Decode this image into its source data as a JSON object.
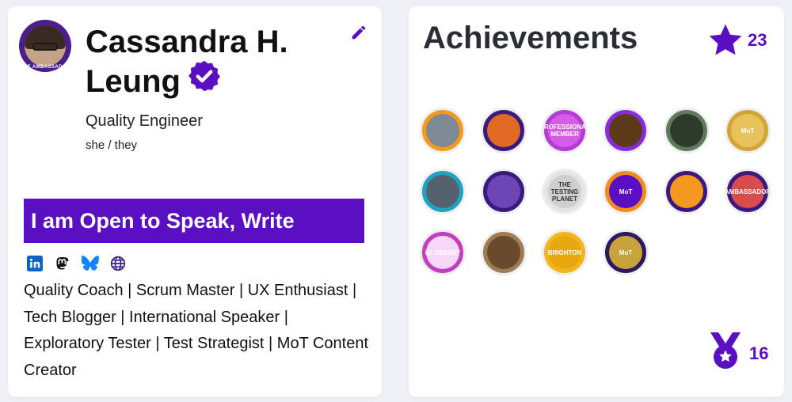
{
  "profile": {
    "avatar_ring_text": "MoT AMBASSADOR",
    "name_line1": "Cassandra H.",
    "name_line2": "Leung",
    "role": "Quality Engineer",
    "pronouns": "she / they",
    "open_to": "I am Open to Speak, Write",
    "socials": [
      {
        "name": "linkedin-icon",
        "color": "#0a66c2"
      },
      {
        "name": "mastodon-icon",
        "color": "#111111"
      },
      {
        "name": "bluesky-icon",
        "color": "#1185fe"
      },
      {
        "name": "globe-icon",
        "color": "#3a1f8f"
      }
    ],
    "bio": "Quality Coach | Scrum Master | UX Enthusiast | Tech Blogger | International Speaker | Exploratory Tester | Test Strategist | MoT Content Creator"
  },
  "achievements": {
    "title": "Achievements",
    "star_count": "23",
    "medal_count": "16",
    "badges": [
      {
        "name": "robot-badge",
        "bg": "#f39a1e",
        "inner": "#7d8a96",
        "label": ""
      },
      {
        "name": "testbash-planet-badge",
        "bg": "#3c1a7d",
        "inner": "#e06a24",
        "label": ""
      },
      {
        "name": "professional-member-badge",
        "bg": "#b33bd6",
        "inner": "#d65be6",
        "label": "PROFESSIONAL MEMBER"
      },
      {
        "name": "meetup-badge",
        "bg": "#8a2be2",
        "inner": "#5d3a1a",
        "label": ""
      },
      {
        "name": "compass-badge",
        "bg": "#5f7a5a",
        "inner": "#2c3b2a",
        "label": ""
      },
      {
        "name": "certification-badge",
        "bg": "#d4a437",
        "inner": "#e8c25a",
        "label": "MoT"
      },
      {
        "name": "graduate-robot-badge",
        "bg": "#1fa2c2",
        "inner": "#546270",
        "label": ""
      },
      {
        "name": "speaker-badge",
        "bg": "#3c1a7d",
        "inner": "#6c46b5",
        "label": ""
      },
      {
        "name": "testing-planet-badge",
        "bg": "#e4e4e4",
        "inner": "#cfcfcf",
        "label": "THE TESTING PLANET"
      },
      {
        "name": "phone-badge",
        "bg": "#f28b1d",
        "inner": "#5a0fc2",
        "label": "MoT"
      },
      {
        "name": "owl-badge",
        "bg": "#3c1a7d",
        "inner": "#f39a1e",
        "label": ""
      },
      {
        "name": "ambassador-badge",
        "bg": "#3c1a7d",
        "inner": "#d94c4c",
        "label": "AMBASSADOR"
      },
      {
        "name": "glossary-badge",
        "bg": "#c03fc0",
        "inner": "#f7d7f7",
        "label": "GLOSSARY"
      },
      {
        "name": "camera-badge",
        "bg": "#a07b55",
        "inner": "#6a4a2c",
        "label": ""
      },
      {
        "name": "testbash-brighton-badge",
        "bg": "#f3b51a",
        "inner": "#e8a810",
        "label": "BRIGHTON"
      },
      {
        "name": "mot-gold-badge",
        "bg": "#2d1a5e",
        "inner": "#c8a23a",
        "label": "MoT"
      }
    ]
  }
}
